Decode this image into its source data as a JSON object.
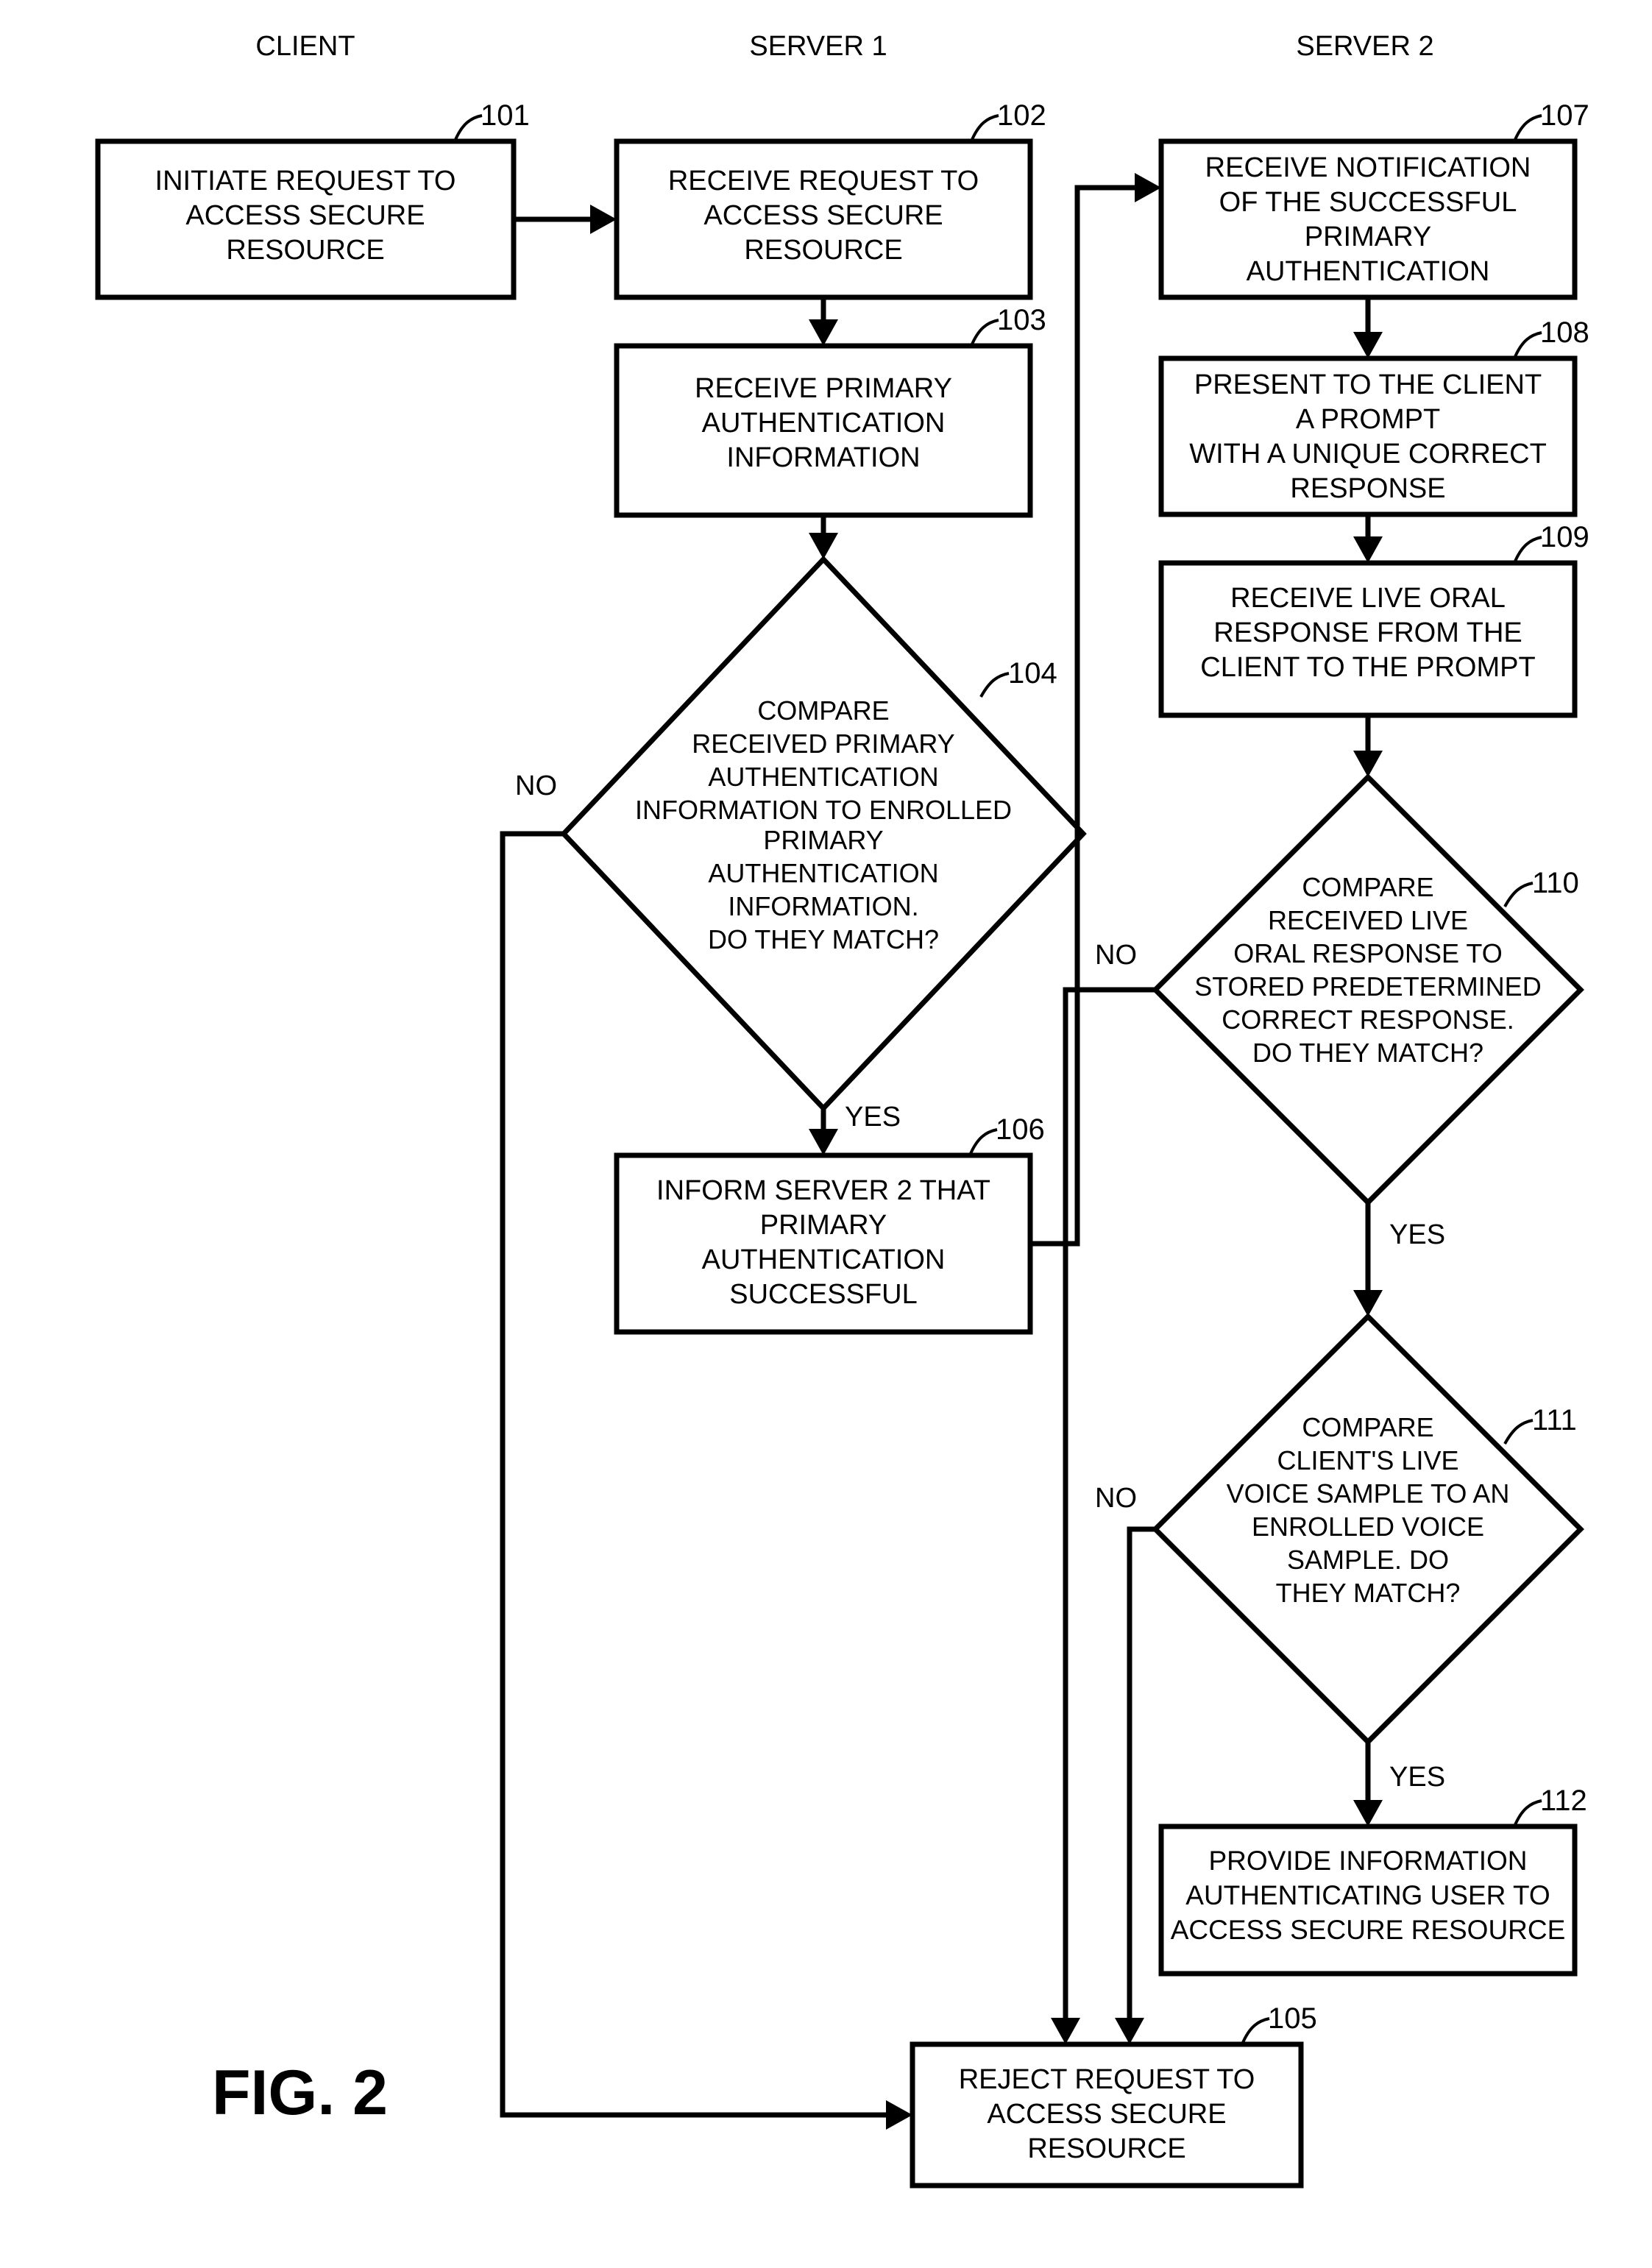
{
  "figure": {
    "label": "FIG. 2",
    "columns": [
      {
        "title": "CLIENT"
      },
      {
        "title": "SERVER 1"
      },
      {
        "title": "SERVER 2"
      }
    ],
    "nodes": [
      {
        "ref": "101",
        "shape": "process",
        "column": "CLIENT",
        "lines": [
          "INITIATE REQUEST TO",
          "ACCESS SECURE",
          "RESOURCE"
        ]
      },
      {
        "ref": "102",
        "shape": "process",
        "column": "SERVER 1",
        "lines": [
          "RECEIVE REQUEST TO",
          "ACCESS SECURE",
          "RESOURCE"
        ]
      },
      {
        "ref": "103",
        "shape": "process",
        "column": "SERVER 1",
        "lines": [
          "RECEIVE PRIMARY",
          "AUTHENTICATION",
          "INFORMATION"
        ]
      },
      {
        "ref": "104",
        "shape": "decision",
        "column": "SERVER 1",
        "lines": [
          "COMPARE",
          "RECEIVED PRIMARY",
          "AUTHENTICATION",
          "INFORMATION TO ENROLLED",
          "PRIMARY",
          "AUTHENTICATION",
          "INFORMATION.",
          "DO THEY MATCH?"
        ]
      },
      {
        "ref": "106",
        "shape": "process",
        "column": "SERVER 1",
        "lines": [
          "INFORM SERVER 2 THAT",
          "PRIMARY",
          "AUTHENTICATION",
          "SUCCESSFUL"
        ]
      },
      {
        "ref": "107",
        "shape": "process",
        "column": "SERVER 2",
        "lines": [
          "RECEIVE NOTIFICATION",
          "OF THE SUCCESSFUL",
          "PRIMARY",
          "AUTHENTICATION"
        ]
      },
      {
        "ref": "108",
        "shape": "process",
        "column": "SERVER 2",
        "lines": [
          "PRESENT TO THE CLIENT",
          "A PROMPT",
          "WITH A UNIQUE CORRECT",
          "RESPONSE"
        ]
      },
      {
        "ref": "109",
        "shape": "process",
        "column": "SERVER 2",
        "lines": [
          "RECEIVE LIVE ORAL",
          "RESPONSE FROM THE",
          "CLIENT TO THE PROMPT"
        ]
      },
      {
        "ref": "110",
        "shape": "decision",
        "column": "SERVER 2",
        "lines": [
          "COMPARE",
          "RECEIVED LIVE",
          "ORAL RESPONSE TO",
          "STORED PREDETERMINED",
          "CORRECT RESPONSE.",
          "DO THEY MATCH?"
        ]
      },
      {
        "ref": "111",
        "shape": "decision",
        "column": "SERVER 2",
        "lines": [
          "COMPARE",
          "CLIENT'S LIVE",
          "VOICE SAMPLE TO AN",
          "ENROLLED VOICE",
          "SAMPLE.  DO",
          "THEY MATCH?"
        ]
      },
      {
        "ref": "112",
        "shape": "process",
        "column": "SERVER 2",
        "lines": [
          "PROVIDE INFORMATION",
          "AUTHENTICATING USER TO",
          "ACCESS SECURE RESOURCE"
        ]
      },
      {
        "ref": "105",
        "shape": "process",
        "column": "SERVER 1",
        "lines": [
          "REJECT REQUEST TO",
          "ACCESS SECURE",
          "RESOURCE"
        ]
      }
    ],
    "edge_labels": {
      "no_104": "NO",
      "yes_104": "YES",
      "no_110": "NO",
      "yes_110": "YES",
      "no_111": "NO",
      "yes_111": "YES"
    },
    "colors": {
      "ink": "#000000",
      "paper": "#ffffff"
    }
  }
}
